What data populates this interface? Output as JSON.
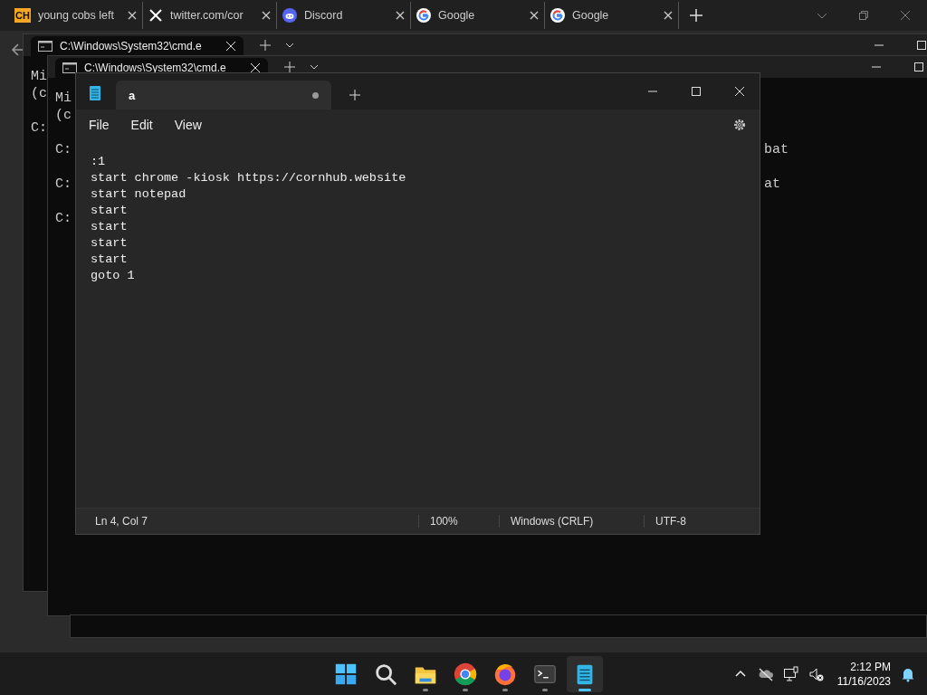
{
  "browser": {
    "tabs": [
      {
        "title": "young cobs left",
        "kind": "ch",
        "favicon_text": "CH",
        "selected": false
      },
      {
        "title": "twitter.com/cor",
        "kind": "x",
        "selected": false
      },
      {
        "title": "Discord",
        "kind": "discord",
        "selected": false
      },
      {
        "title": "Google",
        "kind": "google",
        "selected": false
      },
      {
        "title": "Google",
        "kind": "google",
        "selected": false
      }
    ]
  },
  "terminals": [
    {
      "tab_title": "C:\\Windows\\System32\\cmd.e",
      "blocks": [
        [
          {
            "left": "Mi"
          },
          {
            "left": "(c"
          }
        ],
        [
          {
            "left": "C:"
          }
        ]
      ]
    },
    {
      "tab_title": "C:\\Windows\\System32\\cmd.e",
      "blocks": [
        [
          {
            "left": "Mi"
          },
          {
            "left": "(c"
          }
        ],
        [
          {
            "left": "C:",
            "right": "bat"
          }
        ],
        [
          {
            "left": "C:",
            "right": "at"
          }
        ],
        [
          {
            "left": "C:"
          }
        ]
      ]
    }
  ],
  "notepad": {
    "tab": {
      "title": "a",
      "selected": true,
      "unsaved": true
    },
    "menu": [
      "File",
      "Edit",
      "View"
    ],
    "lines": [
      ":1",
      "start chrome -kiosk https://cornhub.website",
      "start notepad",
      "start",
      "start",
      "start",
      "start",
      "goto 1"
    ],
    "status_bar": {
      "position": "Ln 4, Col 7",
      "zoom": "100%",
      "line_ending": "Windows (CRLF)",
      "encoding": "UTF-8"
    }
  },
  "taskbar": {
    "apps": [
      {
        "kind": "start",
        "selected": false
      },
      {
        "kind": "search",
        "selected": false
      },
      {
        "kind": "explorer",
        "running": true,
        "selected": false
      },
      {
        "kind": "chrome",
        "running": true,
        "selected": false
      },
      {
        "kind": "firefox",
        "running": true,
        "selected": false
      },
      {
        "kind": "terminal",
        "running": true,
        "selected": false
      },
      {
        "kind": "notepad",
        "running": true,
        "selected": true
      }
    ],
    "time": "2:12 PM",
    "date": "11/16/2023"
  }
}
